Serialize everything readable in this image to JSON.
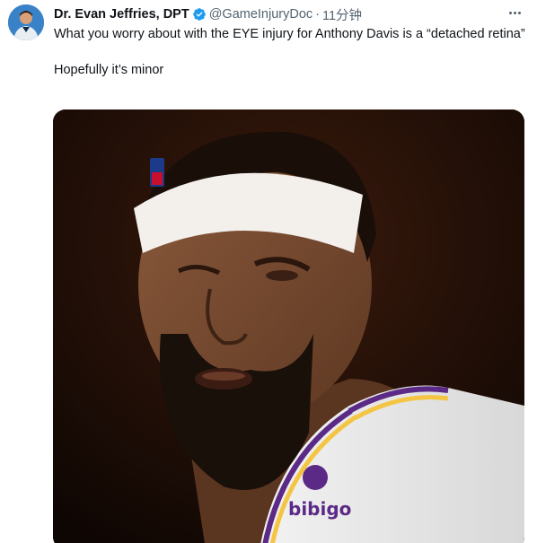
{
  "tweet": {
    "author": {
      "display_name": "Dr. Evan Jeffries, DPT",
      "handle": "@GameInjuryDoc",
      "verified_icon": "verified-badge-icon",
      "avatar": "avatar"
    },
    "separator": "·",
    "time": "11分钟",
    "more_icon": "more-options-icon",
    "text_line1": "What you worry about with the EYE injury for Anthony Davis is a “detached retina”",
    "text_line2": "Hopefully it’s minor",
    "media": {
      "jersey_text": "bibigo",
      "accent_color": "#f4c542",
      "jersey_purple": "#5b2a86"
    }
  }
}
